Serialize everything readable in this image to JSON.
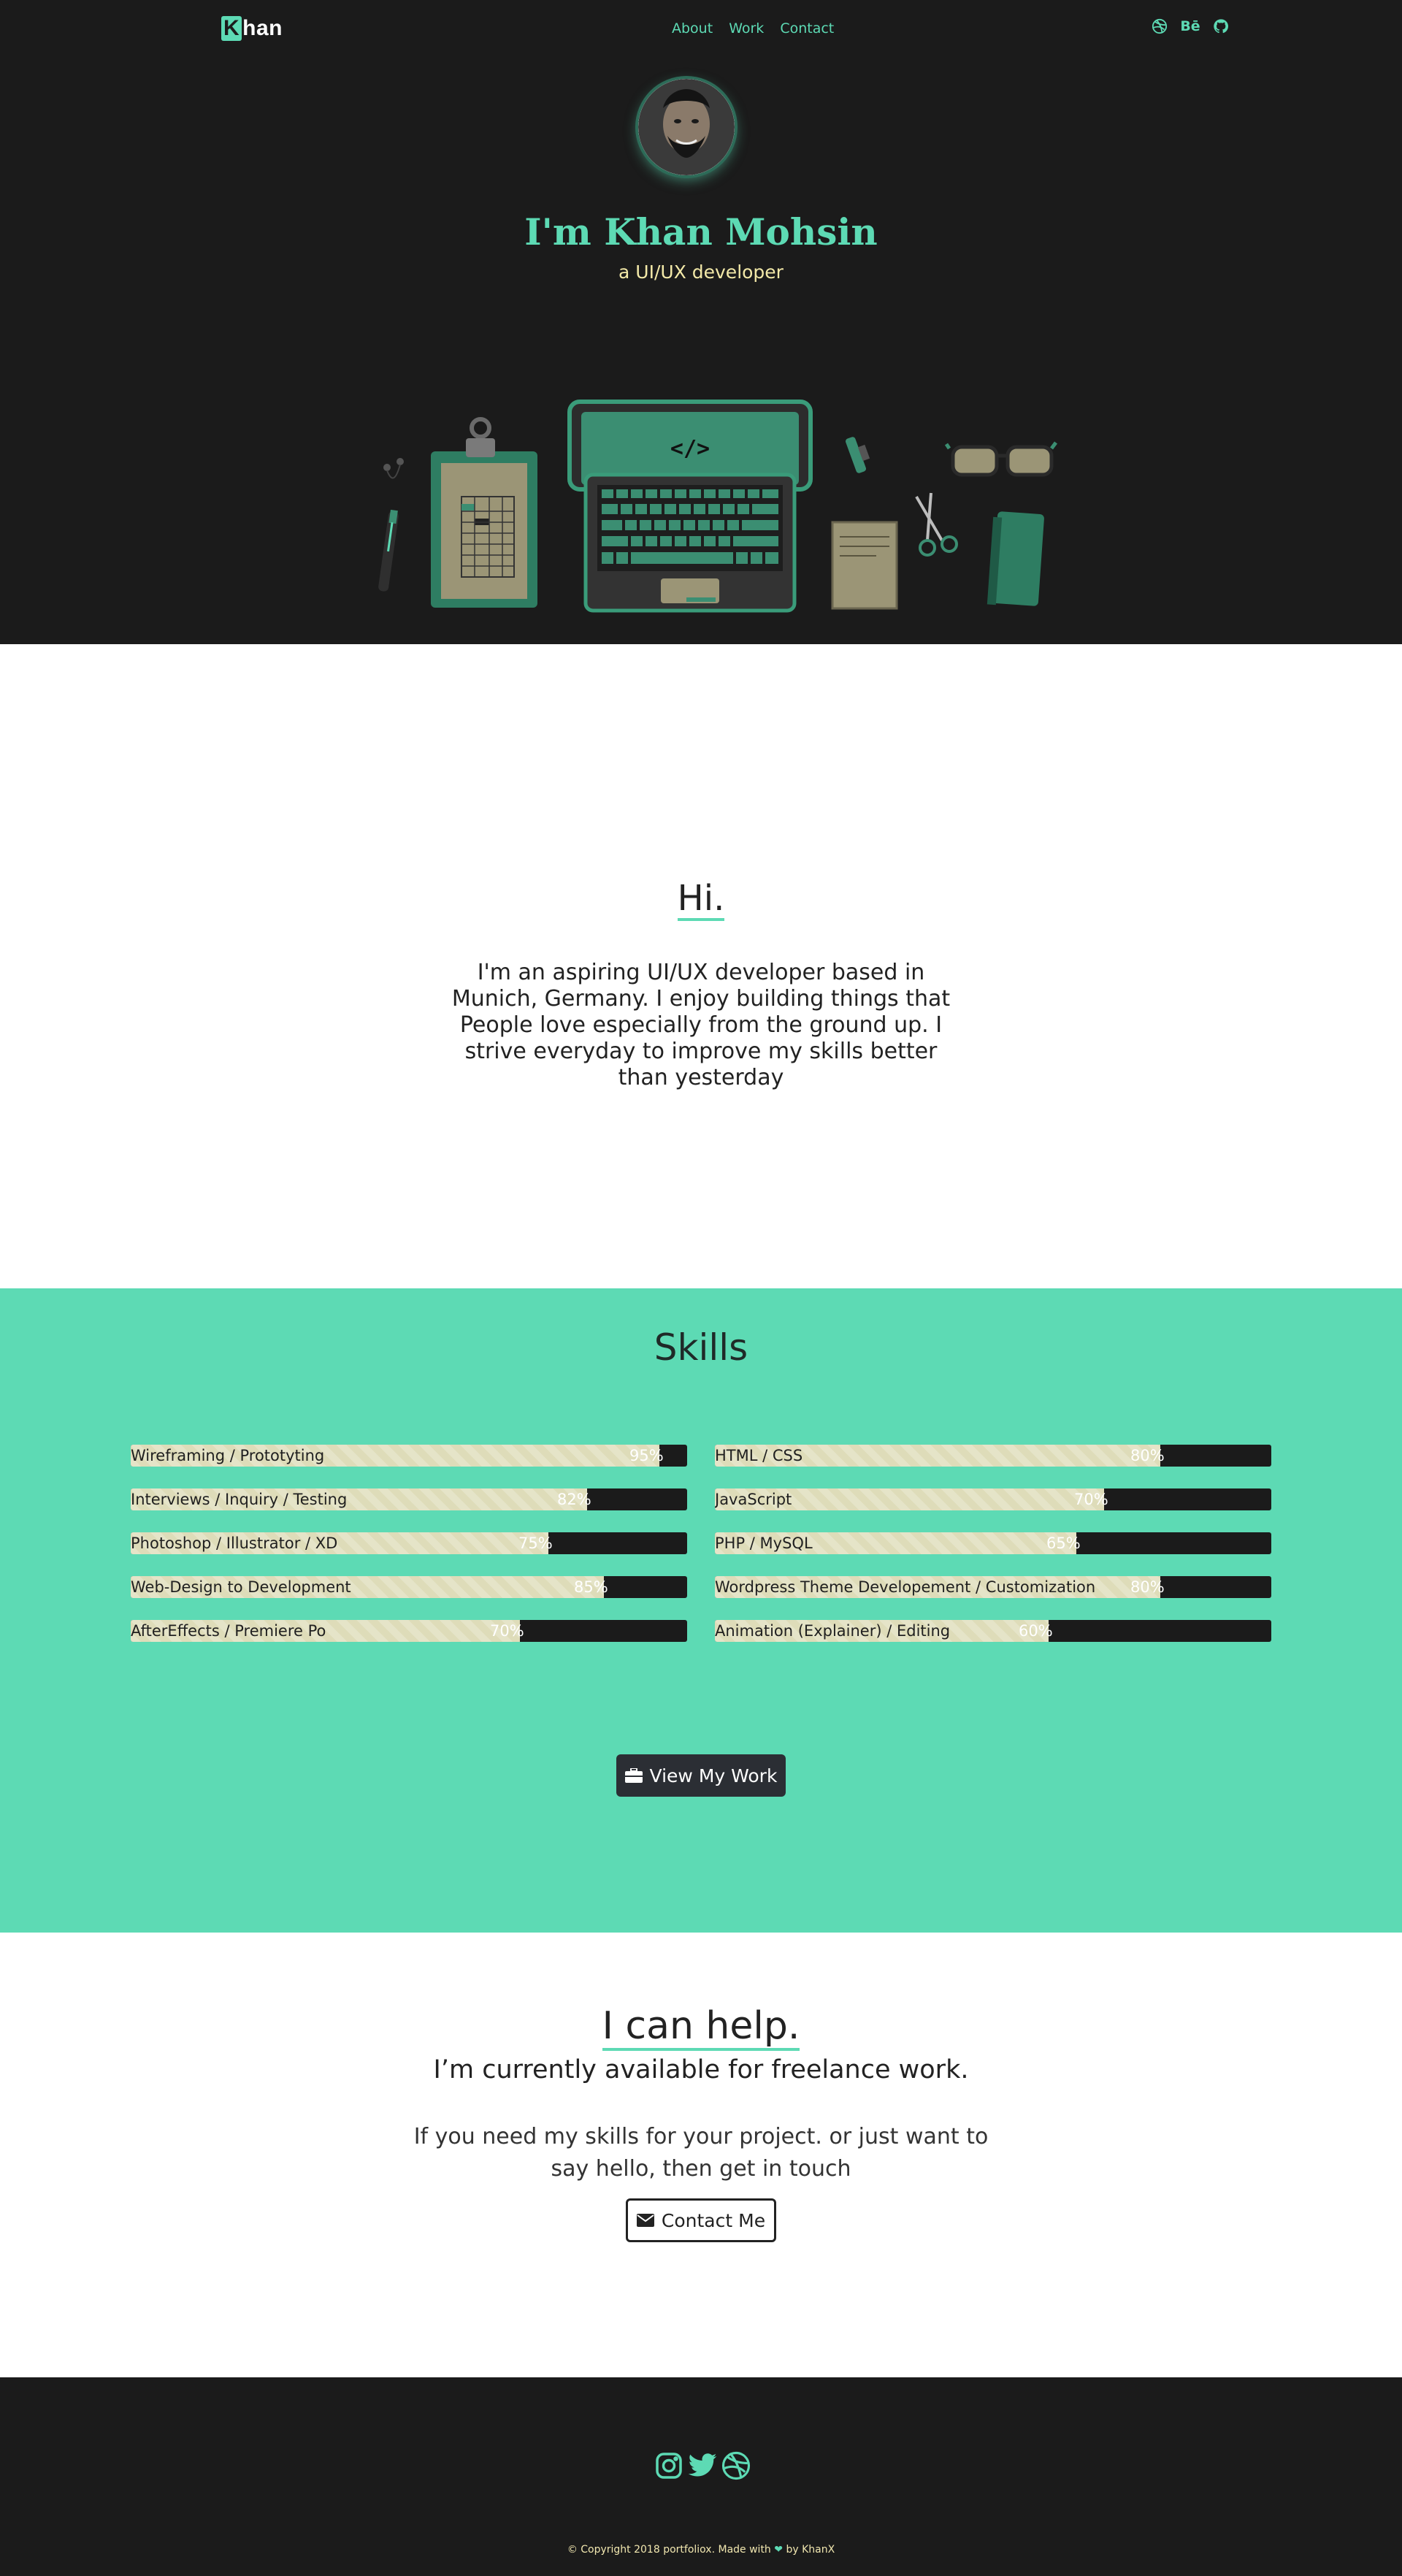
{
  "nav": {
    "brand_k": "K",
    "brand_rest": "han",
    "links": [
      "About",
      "Work",
      "Contact"
    ],
    "social": [
      {
        "icon": "dribbble-icon"
      },
      {
        "icon": "behance-icon",
        "label": "Bē"
      },
      {
        "icon": "github-icon"
      }
    ]
  },
  "hero": {
    "title": "I'm Khan Mohsin",
    "subtitle": "a UI/UX developer",
    "laptop_code": "</>"
  },
  "about": {
    "heading": "Hi.",
    "text": "I'm an aspiring UI/UX developer based in Munich, Germany. I enjoy building things that People love especially from the ground up. I strive everyday to improve my skills better than yesterday"
  },
  "skills": {
    "heading": "Skills",
    "left": [
      {
        "label": "Wireframing / Prototyting",
        "percent": 95,
        "percent_text": "95%"
      },
      {
        "label": "Interviews / Inquiry / Testing",
        "percent": 82,
        "percent_text": "82%"
      },
      {
        "label": "Photoshop / Illustrator / XD",
        "percent": 75,
        "percent_text": "75%"
      },
      {
        "label": "Web-Design to Development",
        "percent": 85,
        "percent_text": "85%"
      },
      {
        "label": "AfterEffects / Premiere Po",
        "percent": 70,
        "percent_text": "70%"
      }
    ],
    "right": [
      {
        "label": "HTML / CSS",
        "percent": 80,
        "percent_text": "80%"
      },
      {
        "label": "JavaScript",
        "percent": 70,
        "percent_text": "70%"
      },
      {
        "label": "PHP / MySQL",
        "percent": 65,
        "percent_text": "65%"
      },
      {
        "label": "Wordpress Theme Developement / Customization",
        "percent": 80,
        "percent_text": "80%"
      },
      {
        "label": "Animation (Explainer) / Editing",
        "percent": 60,
        "percent_text": "60%"
      }
    ],
    "button_label": "View My Work",
    "button_icon": "briefcase-icon"
  },
  "help": {
    "heading": "I can help.",
    "subheading": "I’m currently available for freelance work.",
    "text": "If you need my skills for your project. or just want to say hello, then get in touch",
    "button_label": "Contact Me",
    "button_icon": "envelope-icon"
  },
  "footer": {
    "social": [
      "instagram-icon",
      "twitter-icon",
      "dribbble-icon"
    ],
    "copyright_prefix": "© Copyright 2018 portfoliox. Made with",
    "copyright_suffix": "by KhanX"
  },
  "colors": {
    "accent": "#5ddab4",
    "dark": "#1b1b1b",
    "cream": "#f3e9a8",
    "bar_fill": "#dedcb9",
    "button_dark": "#2b2e34"
  }
}
